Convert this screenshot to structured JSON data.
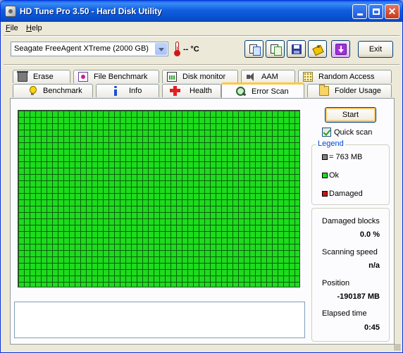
{
  "window": {
    "title": "HD Tune Pro 3.50 - Hard Disk Utility"
  },
  "menu": {
    "file": "File",
    "file_accel": "F",
    "file_rest": "ile",
    "help": "Help",
    "help_accel": "H",
    "help_rest": "elp"
  },
  "toolbar": {
    "drive": "Seagate FreeAgent XTreme (2000 GB)",
    "temperature": "-- °C",
    "exit_label": "Exit",
    "icons": [
      "copy-text-icon",
      "copy-screenshot-icon",
      "save-icon",
      "options-icon",
      "exit-down-icon"
    ]
  },
  "tabs": {
    "row_top": [
      {
        "label": "Erase",
        "icon": "trash-icon"
      },
      {
        "label": "File Benchmark",
        "icon": "file-benchmark-icon"
      },
      {
        "label": "Disk monitor",
        "icon": "disk-monitor-icon"
      },
      {
        "label": "AAM",
        "icon": "speaker-icon"
      },
      {
        "label": "Random Access",
        "icon": "random-access-icon"
      }
    ],
    "row_bottom": [
      {
        "label": "Benchmark",
        "icon": "lightbulb-icon"
      },
      {
        "label": "Info",
        "icon": "info-icon"
      },
      {
        "label": "Health",
        "icon": "health-cross-icon"
      },
      {
        "label": "Error Scan",
        "icon": "magnifier-icon",
        "active": true
      },
      {
        "label": "Folder Usage",
        "icon": "folder-icon"
      }
    ]
  },
  "error_scan": {
    "start_label": "Start",
    "quick_scan_label": "Quick scan",
    "quick_scan_checked": true,
    "legend": {
      "title": "Legend",
      "block_size": "= 763 MB",
      "ok": "Ok",
      "damaged": "Damaged",
      "colors": {
        "block": "#808080",
        "ok": "#1ddc1d",
        "damaged": "#c81414"
      }
    },
    "stats": {
      "damaged_blocks_label": "Damaged blocks",
      "damaged_blocks_value": "0.0 %",
      "scanning_speed_label": "Scanning speed",
      "scanning_speed_value": "n/a",
      "position_label": "Position",
      "position_value": "-190187 MB",
      "elapsed_time_label": "Elapsed time",
      "elapsed_time_value": "0:45"
    },
    "grid_state": "all blocks ok"
  }
}
